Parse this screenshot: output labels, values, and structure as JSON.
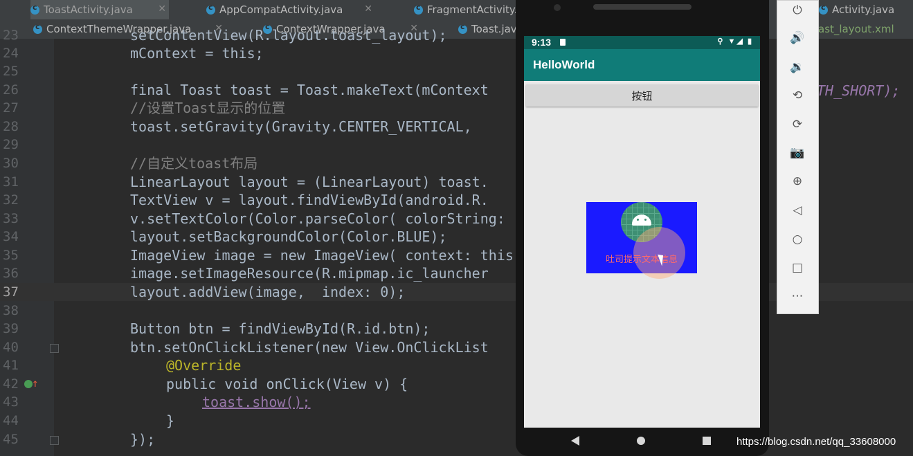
{
  "tabs": {
    "row1": [
      "ToastActivity.java",
      "AppCompatActivity.java",
      "FragmentActivity.",
      "Activity.java"
    ],
    "row2": [
      "ContextThemeWrapper.java",
      "ContextWrapper.java",
      "Toast.jav",
      "ast_layout.xml"
    ]
  },
  "editor": {
    "current_line": "37",
    "lines": [
      {
        "n": "23",
        "text": "setContentView(R.layout.toast_layout);"
      },
      {
        "n": "24",
        "text": "mContext = this;"
      },
      {
        "n": "25",
        "text": ""
      },
      {
        "n": "26",
        "text": "final Toast toast = Toast.makeText(mContext"
      },
      {
        "n": "27",
        "text": "//设置Toast显示的位置"
      },
      {
        "n": "28",
        "text": "toast.setGravity(Gravity.CENTER_VERTICAL,"
      },
      {
        "n": "29",
        "text": ""
      },
      {
        "n": "30",
        "text": "//自定义toast布局"
      },
      {
        "n": "31",
        "text": "LinearLayout layout = (LinearLayout) toast."
      },
      {
        "n": "32",
        "text": "TextView v = layout.findViewById(android.R."
      },
      {
        "n": "33",
        "text": "v.setTextColor(Color.parseColor( colorString: \""
      },
      {
        "n": "34",
        "text": "layout.setBackgroundColor(Color.BLUE);"
      },
      {
        "n": "35",
        "text": "ImageView image = new ImageView( context: this"
      },
      {
        "n": "36",
        "text": "image.setImageResource(R.mipmap.ic_launcher"
      },
      {
        "n": "37",
        "text": "layout.addView(image,  index: 0);"
      },
      {
        "n": "38",
        "text": ""
      },
      {
        "n": "39",
        "text": "Button btn = findViewById(R.id.btn);"
      },
      {
        "n": "40",
        "text": "btn.setOnClickListener(new View.OnClickList"
      },
      {
        "n": "41",
        "text": "@Override"
      },
      {
        "n": "42",
        "text": "public void onClick(View v) {"
      },
      {
        "n": "43",
        "text": "toast.show();"
      },
      {
        "n": "44",
        "text": "}"
      },
      {
        "n": "45",
        "text": "});"
      }
    ],
    "overflow_right": "TH_SHORT);"
  },
  "emulator": {
    "time": "9:13",
    "app_title": "HelloWorld",
    "button_label": "按钮",
    "toast_text": "吐司提示文本信息",
    "toolbar_icons": [
      "power-icon",
      "volume-up-icon",
      "volume-down-icon",
      "rotate-left-icon",
      "rotate-right-icon",
      "camera-icon",
      "zoom-icon",
      "back-icon",
      "home-icon",
      "overview-icon",
      "more-icon"
    ]
  },
  "watermark": "https://blog.csdn.net/qq_33608000",
  "colors": {
    "editor_bg": "#2b2b2b",
    "keyword": "#cc7832",
    "field": "#9876aa",
    "appbar": "#107c78",
    "toast_bg": "#1a1aff"
  }
}
